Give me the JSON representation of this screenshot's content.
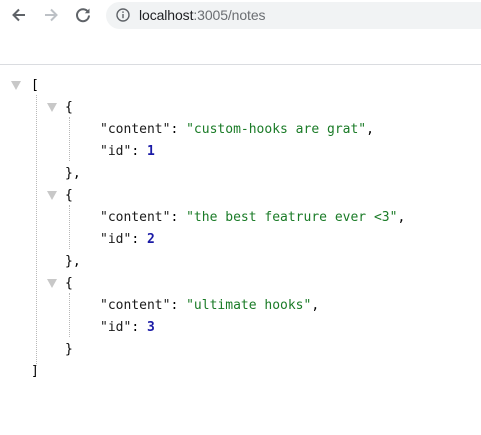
{
  "browser": {
    "url_host": "localhost",
    "url_rest": ":3005/notes"
  },
  "json": {
    "open_root": "[",
    "close_root": "]",
    "items": [
      {
        "open": "{",
        "content_key": "\"content\"",
        "content_value": "\"custom-hooks are grat\"",
        "id_key": "\"id\"",
        "id_value": "1",
        "close": "},"
      },
      {
        "open": "{",
        "content_key": "\"content\"",
        "content_value": "\"the best featrure ever <3\"",
        "id_key": "\"id\"",
        "id_value": "2",
        "close": "},"
      },
      {
        "open": "{",
        "content_key": "\"content\"",
        "content_value": "\"ultimate hooks\"",
        "id_key": "\"id\"",
        "id_value": "3",
        "close": "}"
      }
    ]
  },
  "colors": {
    "string": "#1a7b27",
    "number": "#1a1aa6",
    "triangle": "#c8c8c8"
  }
}
